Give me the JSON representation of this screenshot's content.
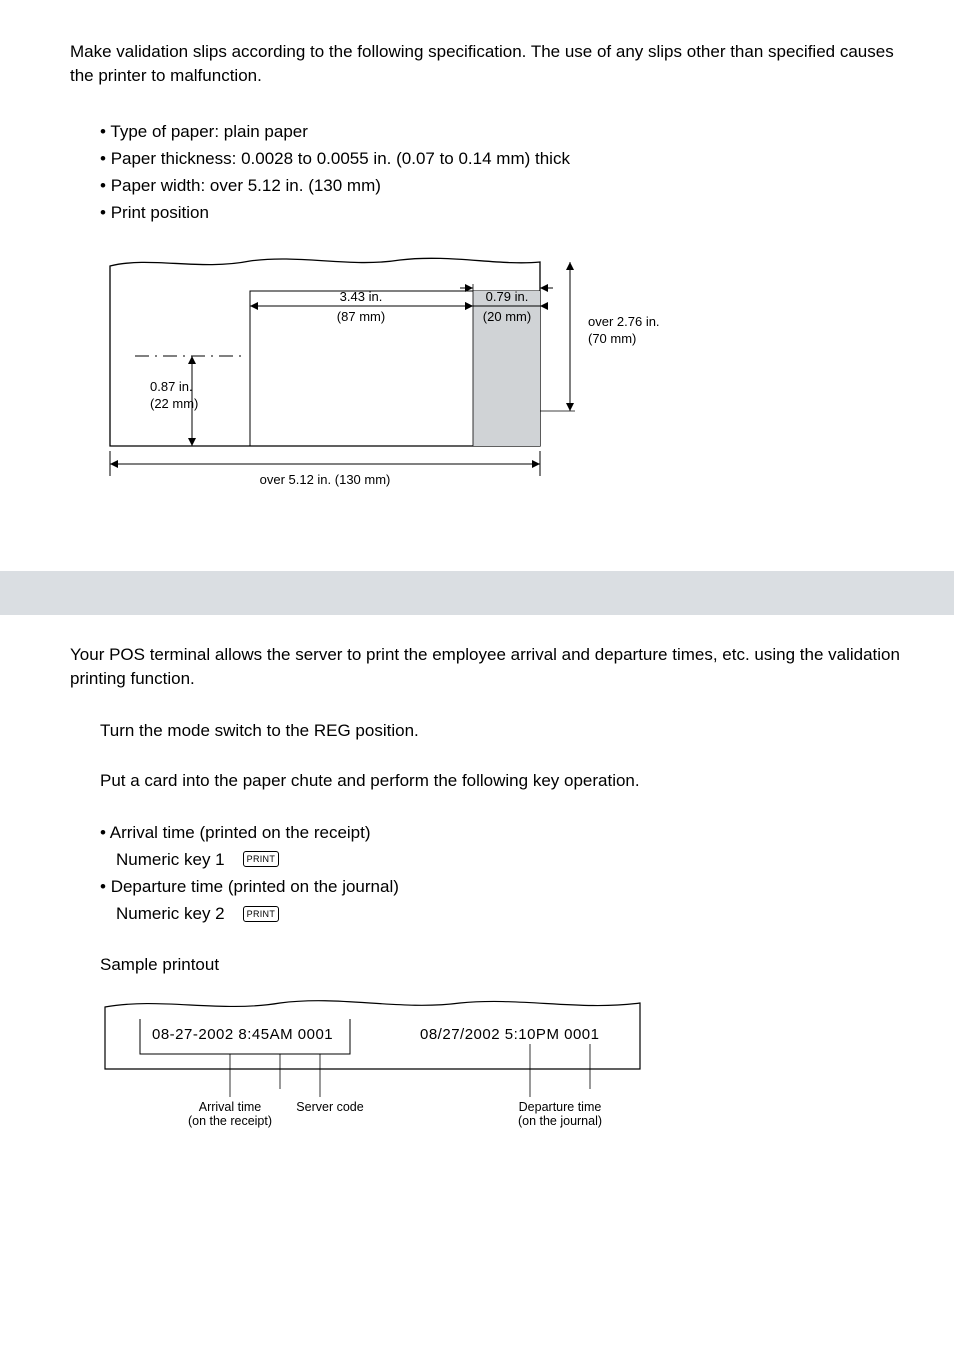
{
  "intro": "Make validation slips according to the following specification. The use of any slips other than specified causes the printer to malfunction.",
  "specs": {
    "paper_type": "Type of paper: plain paper",
    "thickness": "Paper thickness: 0.0028 to 0.0055 in. (0.07 to 0.14 mm) thick",
    "width": "Paper width: over 5.12 in. (130 mm)",
    "position": "Print position"
  },
  "diagram": {
    "wd87_in": "3.43 in.",
    "wd87_mm": "(87 mm)",
    "wd20_in": "0.79 in.",
    "wd20_mm": "(20 mm)",
    "ht70_in": "over 2.76 in.",
    "ht70_mm": "(70 mm)",
    "ht22_in": "0.87 in.",
    "ht22_mm": "(22 mm)",
    "total_width": "over 5.12 in. (130 mm)"
  },
  "pos_intro": "Your POS terminal allows the server to print the employee arrival and departure times, etc. using the validation printing function.",
  "step1": "Turn the mode switch to the REG position.",
  "step2": "Put a card into the paper chute and perform the following key operation.",
  "arrival": {
    "desc": "Arrival time (printed on the receipt)",
    "key": "Numeric key 1",
    "btn": "PRINT"
  },
  "departure": {
    "desc": "Departure time (printed on the journal)",
    "key": "Numeric key 2",
    "btn": "PRINT"
  },
  "sample_label": "Sample printout",
  "sample": {
    "left_text": "08-27-2002  8:45AM 0001",
    "right_text": "08/27/2002  5:10PM 0001",
    "label_arrival_1": "Arrival time",
    "label_arrival_2": "(on the receipt)",
    "label_server": "Server code",
    "label_departure_1": "Departure time",
    "label_departure_2": "(on the journal)"
  }
}
